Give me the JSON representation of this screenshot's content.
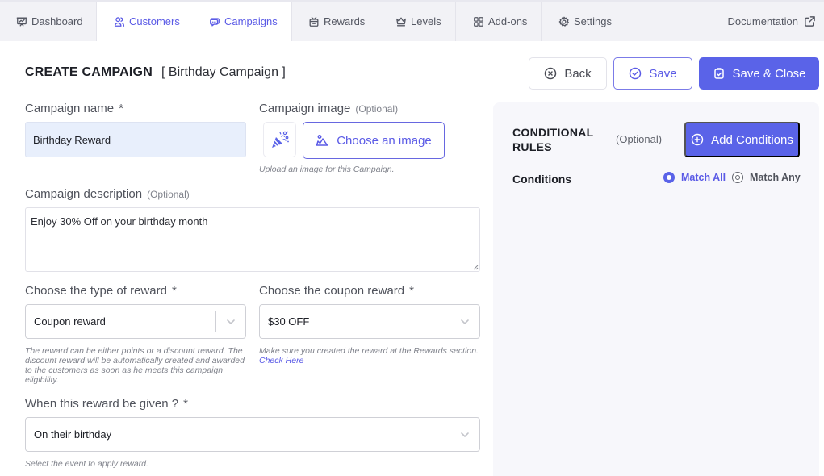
{
  "nav": {
    "tabs": [
      {
        "label": "Dashboard",
        "icon": "presentation-icon",
        "active": false
      },
      {
        "label": "Customers",
        "icon": "users-icon",
        "active": false
      },
      {
        "label": "Campaigns",
        "icon": "chat-bubbles-icon",
        "active": true
      },
      {
        "label": "Rewards",
        "icon": "gift-box-icon",
        "active": false
      },
      {
        "label": "Levels",
        "icon": "crown-icon",
        "active": false
      },
      {
        "label": "Add-ons",
        "icon": "grid-icon",
        "active": false
      },
      {
        "label": "Settings",
        "icon": "gear-icon",
        "active": false
      }
    ],
    "documentation": {
      "label": "Documentation",
      "icon": "external-link-icon"
    }
  },
  "header": {
    "title": "CREATE CAMPAIGN",
    "subtitle": "[ Birthday Campaign ]",
    "buttons": {
      "back": "Back",
      "save": "Save",
      "save_close": "Save & Close"
    }
  },
  "form": {
    "campaign_name": {
      "label": "Campaign name",
      "required": "*",
      "value": "Birthday Reward"
    },
    "campaign_image": {
      "label": "Campaign image",
      "optional": "(Optional)",
      "thumbnail_icon": "party-popper-icon",
      "button": "Choose an image",
      "hint": "Upload an image for this Campaign."
    },
    "campaign_description": {
      "label": "Campaign description",
      "optional": "(Optional)",
      "value": "Enjoy 30% Off on your birthday month"
    },
    "reward_type": {
      "label": "Choose the type of reward",
      "required": "*",
      "value": "Coupon reward",
      "hint": "The reward can be either points or a discount reward. The discount reward will be automatically created and awarded to the customers as soon as he meets this campaign eligibility."
    },
    "coupon_reward": {
      "label": "Choose the coupon reward",
      "required": "*",
      "value": "$30 OFF",
      "hint": "Make sure you created the reward at the Rewards section.",
      "hint_link": "Check Here"
    },
    "trigger": {
      "label": "When this reward be given ?",
      "required": "*",
      "value": "On their birthday",
      "hint": "Select the event to apply reward."
    }
  },
  "conditional_rules": {
    "title": "CONDITIONAL RULES",
    "optional": "(Optional)",
    "add_button": "Add Conditions",
    "conditions_label": "Conditions",
    "match_options": [
      {
        "label": "Match All",
        "selected": true
      },
      {
        "label": "Match Any",
        "selected": false
      }
    ]
  },
  "colors": {
    "accent": "#5a63e8",
    "nav_bg": "#f2f2f6",
    "panel_bg": "#f7f7fb",
    "name_input_bg": "#e8effc"
  }
}
